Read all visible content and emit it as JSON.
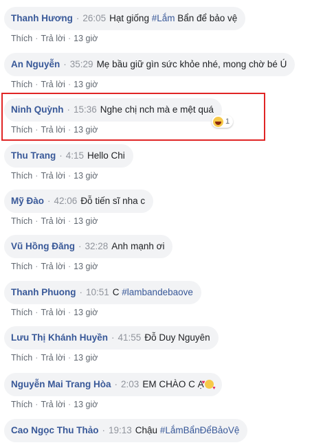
{
  "actions": {
    "like": "Thích",
    "reply": "Trả lời",
    "ago": "13 giờ"
  },
  "comments": [
    {
      "name": "Thanh Hương",
      "time": "26:05",
      "text_before": "Hạt giống ",
      "tag": "#Lắm",
      "text_after": " Bẩn để bảo vệ"
    },
    {
      "name": "An Nguyễn",
      "time": "35:29",
      "text_before": "Mẹ bầu giữ gìn sức khỏe nhé, mong chờ bé Ú",
      "tag": "",
      "text_after": ""
    },
    {
      "name": "Ninh Quỳnh",
      "time": "15:36",
      "text_before": "Nghe chị nch mà e mệt quá",
      "tag": "",
      "text_after": "",
      "reaction": {
        "icon": "laughing-emoji-icon",
        "count": "1"
      }
    },
    {
      "name": "Thu Trang",
      "time": "4:15",
      "text_before": "Hello Chi",
      "tag": "",
      "text_after": ""
    },
    {
      "name": "Mỹ Đào",
      "time": "42:06",
      "text_before": "Đỗ tiến sĩ nha c",
      "tag": "",
      "text_after": ""
    },
    {
      "name": "Vũ Hồng Đăng",
      "time": "32:28",
      "text_before": "Anh mạnh ơi",
      "tag": "",
      "text_after": ""
    },
    {
      "name": "Thanh Phuong",
      "time": "10:51",
      "text_before": "C ",
      "tag": "#lambandebaove",
      "text_after": ""
    },
    {
      "name": "Lưu Thị Khánh Huyền",
      "time": "41:55",
      "text_before": "Đỗ Duy Nguyên",
      "tag": "",
      "text_after": ""
    },
    {
      "name": "Nguyễn Mai Trang Hòa",
      "time": "2:03",
      "text_before": "EM CHÀO C Ạ",
      "tag": "",
      "text_after": "",
      "emoji": "smiling-face-with-hearts-icon"
    },
    {
      "name": "Cao Ngọc Thu Thảo",
      "time": "19:13",
      "text_before": "Chậu ",
      "tag": "#LắmBẩnĐểBảoVệ",
      "text_after": ""
    }
  ],
  "colors": {
    "name": "#385898",
    "bubble": "#f2f3f5",
    "highlight": "#e02424"
  }
}
